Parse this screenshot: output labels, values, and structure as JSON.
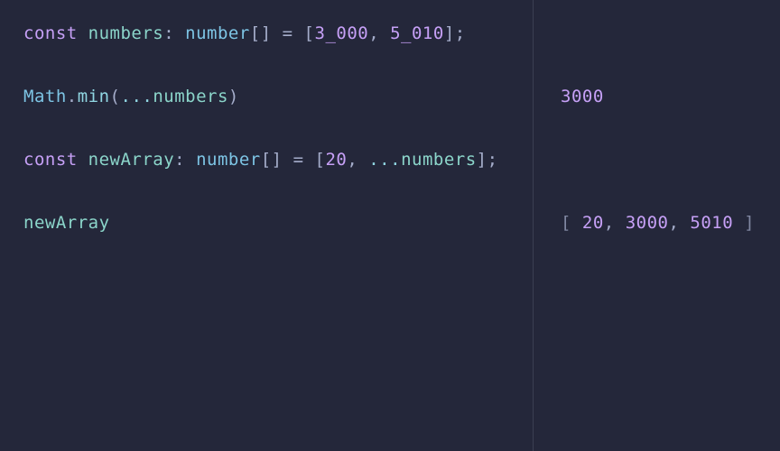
{
  "code": {
    "line1": {
      "kw_const": "const",
      "ident": "numbers",
      "colon": ":",
      "type": "number",
      "brackets_open": "[",
      "brackets_close": "]",
      "eq": "=",
      "arr_open": "[",
      "val1": "3_000",
      "comma": ",",
      "val2": "5_010",
      "arr_close": "]",
      "semi": ";"
    },
    "line2": {
      "global": "Math",
      "dot": ".",
      "method": "min",
      "paren_open": "(",
      "spread": "...",
      "ident": "numbers",
      "paren_close": ")"
    },
    "line3": {
      "kw_const": "const",
      "ident": "newArray",
      "colon": ":",
      "type": "number",
      "brackets_open": "[",
      "brackets_close": "]",
      "eq": "=",
      "arr_open": "[",
      "val1": "20",
      "comma": ",",
      "spread": "...",
      "ident2": "numbers",
      "arr_close": "]",
      "semi": ";"
    },
    "line4": {
      "ident": "newArray"
    }
  },
  "output": {
    "line2": {
      "val": "3000"
    },
    "line4": {
      "open": "[",
      "v1": "20",
      "c1": ",",
      "v2": "3000",
      "c2": ",",
      "v3": "5010",
      "close": "]"
    }
  },
  "colors": {
    "bg": "#24273a",
    "keyword": "#c6a0f6",
    "identifier": "#8bd5ca",
    "type": "#7dc4e4",
    "punctuation": "#a5adcb"
  }
}
